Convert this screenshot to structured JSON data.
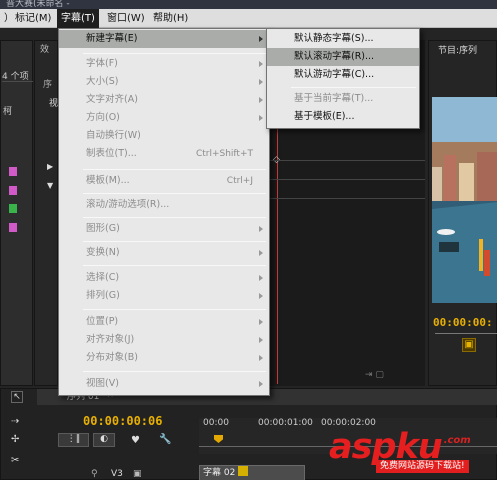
{
  "window": {
    "title_fragment": "普大赛(未命名 -"
  },
  "menubar": {
    "items": [
      {
        "label": "）"
      },
      {
        "label": "标记(M)"
      },
      {
        "label": "字幕(T)"
      },
      {
        "label": "窗口(W)"
      },
      {
        "label": "帮助(H)"
      }
    ]
  },
  "left_panel": {
    "count_label": "4 个项",
    "tab_glyph": "序",
    "sub_glyph": "视",
    "side_glyph": "柯",
    "clip_colors": [
      "#d15ac8",
      "#d15ac8",
      "#39b44a",
      "#d15ac8"
    ]
  },
  "source_panel": {
    "tab_label": "效"
  },
  "program_panel": {
    "tab_label": "节目:序列",
    "timecode": "00:00:00:"
  },
  "timeline": {
    "tab_label": "序列 01",
    "timecode": "00:00:00:06",
    "ruler": [
      "00:00",
      "00:00:01:00",
      "00:00:02:00"
    ],
    "track_label": "V3",
    "clip_label": "字幕 02"
  },
  "title_menu": {
    "items": [
      {
        "label": "新建字幕(E)",
        "shortcut": "",
        "submenu": true,
        "disabled": false,
        "highlighted": true
      },
      {
        "label": "字体(F)",
        "shortcut": "",
        "submenu": true,
        "disabled": true
      },
      {
        "label": "大小(S)",
        "shortcut": "",
        "submenu": true,
        "disabled": true
      },
      {
        "label": "文字对齐(A)",
        "shortcut": "",
        "submenu": true,
        "disabled": true
      },
      {
        "label": "方向(O)",
        "shortcut": "",
        "submenu": true,
        "disabled": true
      },
      {
        "label": "自动换行(W)",
        "shortcut": "",
        "submenu": false,
        "disabled": true
      },
      {
        "label": "制表位(T)...",
        "shortcut": "Ctrl+Shift+T",
        "submenu": false,
        "disabled": true
      },
      {
        "label": "模板(M)...",
        "shortcut": "Ctrl+J",
        "submenu": false,
        "disabled": true
      },
      {
        "label": "滚动/游动选项(R)...",
        "shortcut": "",
        "submenu": false,
        "disabled": true
      },
      {
        "label": "图形(G)",
        "shortcut": "",
        "submenu": true,
        "disabled": true
      },
      {
        "label": "变换(N)",
        "shortcut": "",
        "submenu": true,
        "disabled": true
      },
      {
        "label": "选择(C)",
        "shortcut": "",
        "submenu": true,
        "disabled": true
      },
      {
        "label": "排列(G)",
        "shortcut": "",
        "submenu": true,
        "disabled": true
      },
      {
        "label": "位置(P)",
        "shortcut": "",
        "submenu": true,
        "disabled": true
      },
      {
        "label": "对齐对象(J)",
        "shortcut": "",
        "submenu": true,
        "disabled": true
      },
      {
        "label": "分布对象(B)",
        "shortcut": "",
        "submenu": true,
        "disabled": true
      },
      {
        "label": "视图(V)",
        "shortcut": "",
        "submenu": true,
        "disabled": true
      }
    ]
  },
  "new_title_submenu": {
    "items": [
      {
        "label": "默认静态字幕(S)...",
        "disabled": false,
        "highlighted": false
      },
      {
        "label": "默认滚动字幕(R)...",
        "disabled": false,
        "highlighted": true
      },
      {
        "label": "默认游动字幕(C)...",
        "disabled": false,
        "highlighted": false
      },
      {
        "label": "基于当前字幕(T)...",
        "disabled": true,
        "highlighted": false
      },
      {
        "label": "基于模板(E)...",
        "disabled": false,
        "highlighted": false
      }
    ]
  },
  "watermark": {
    "brand": "aspku",
    "tld": ".com",
    "tagline": "免费网站源码下载站!"
  }
}
